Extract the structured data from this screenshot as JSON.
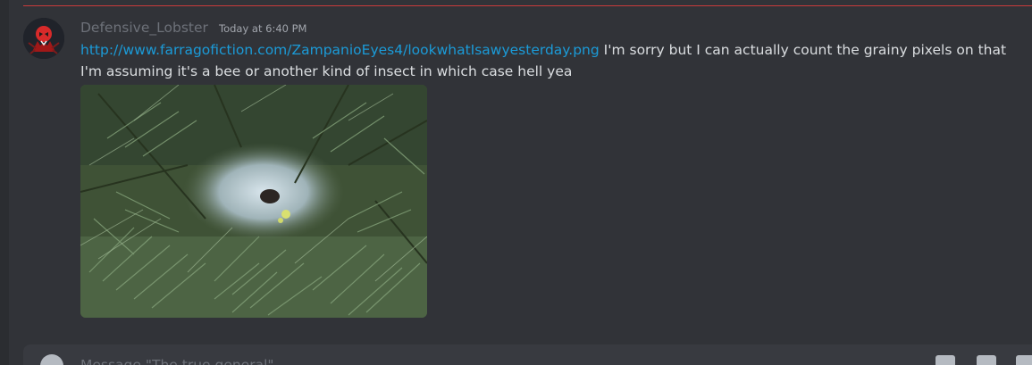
{
  "message": {
    "username": "Defensive_Lobster",
    "timestamp": "Today at 6:40 PM",
    "link": "http://www.farragofiction.com/ZampanioEyes4/lookwhatIsawyesterday.png",
    "line1_text": " I'm sorry but I can actually count the grainy pixels on that",
    "line2_text": "I'm assuming it's a bee or another kind of insect in which case hell yea"
  },
  "composer": {
    "placeholder": "Message \"The true general\""
  },
  "icons": {
    "avatar": "avatar-red-figure-icon",
    "plus": "plus-circle-icon",
    "gift": "gift-icon",
    "gif": "gif-icon",
    "sticker": "sticker-icon"
  },
  "colors": {
    "background": "#313338",
    "link": "#1b9bd8",
    "new_messages_divider": "#c83b3b"
  }
}
